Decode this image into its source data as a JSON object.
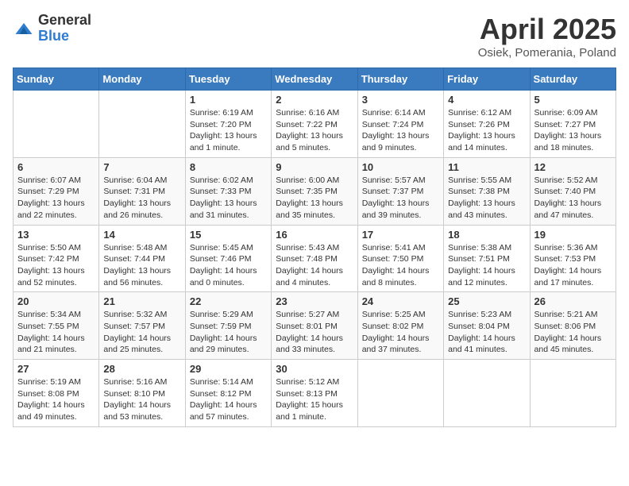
{
  "logo": {
    "general": "General",
    "blue": "Blue"
  },
  "header": {
    "month": "April 2025",
    "location": "Osiek, Pomerania, Poland"
  },
  "weekdays": [
    "Sunday",
    "Monday",
    "Tuesday",
    "Wednesday",
    "Thursday",
    "Friday",
    "Saturday"
  ],
  "weeks": [
    [
      {
        "day": "",
        "info": ""
      },
      {
        "day": "",
        "info": ""
      },
      {
        "day": "1",
        "info": "Sunrise: 6:19 AM\nSunset: 7:20 PM\nDaylight: 13 hours and 1 minute."
      },
      {
        "day": "2",
        "info": "Sunrise: 6:16 AM\nSunset: 7:22 PM\nDaylight: 13 hours and 5 minutes."
      },
      {
        "day": "3",
        "info": "Sunrise: 6:14 AM\nSunset: 7:24 PM\nDaylight: 13 hours and 9 minutes."
      },
      {
        "day": "4",
        "info": "Sunrise: 6:12 AM\nSunset: 7:26 PM\nDaylight: 13 hours and 14 minutes."
      },
      {
        "day": "5",
        "info": "Sunrise: 6:09 AM\nSunset: 7:27 PM\nDaylight: 13 hours and 18 minutes."
      }
    ],
    [
      {
        "day": "6",
        "info": "Sunrise: 6:07 AM\nSunset: 7:29 PM\nDaylight: 13 hours and 22 minutes."
      },
      {
        "day": "7",
        "info": "Sunrise: 6:04 AM\nSunset: 7:31 PM\nDaylight: 13 hours and 26 minutes."
      },
      {
        "day": "8",
        "info": "Sunrise: 6:02 AM\nSunset: 7:33 PM\nDaylight: 13 hours and 31 minutes."
      },
      {
        "day": "9",
        "info": "Sunrise: 6:00 AM\nSunset: 7:35 PM\nDaylight: 13 hours and 35 minutes."
      },
      {
        "day": "10",
        "info": "Sunrise: 5:57 AM\nSunset: 7:37 PM\nDaylight: 13 hours and 39 minutes."
      },
      {
        "day": "11",
        "info": "Sunrise: 5:55 AM\nSunset: 7:38 PM\nDaylight: 13 hours and 43 minutes."
      },
      {
        "day": "12",
        "info": "Sunrise: 5:52 AM\nSunset: 7:40 PM\nDaylight: 13 hours and 47 minutes."
      }
    ],
    [
      {
        "day": "13",
        "info": "Sunrise: 5:50 AM\nSunset: 7:42 PM\nDaylight: 13 hours and 52 minutes."
      },
      {
        "day": "14",
        "info": "Sunrise: 5:48 AM\nSunset: 7:44 PM\nDaylight: 13 hours and 56 minutes."
      },
      {
        "day": "15",
        "info": "Sunrise: 5:45 AM\nSunset: 7:46 PM\nDaylight: 14 hours and 0 minutes."
      },
      {
        "day": "16",
        "info": "Sunrise: 5:43 AM\nSunset: 7:48 PM\nDaylight: 14 hours and 4 minutes."
      },
      {
        "day": "17",
        "info": "Sunrise: 5:41 AM\nSunset: 7:50 PM\nDaylight: 14 hours and 8 minutes."
      },
      {
        "day": "18",
        "info": "Sunrise: 5:38 AM\nSunset: 7:51 PM\nDaylight: 14 hours and 12 minutes."
      },
      {
        "day": "19",
        "info": "Sunrise: 5:36 AM\nSunset: 7:53 PM\nDaylight: 14 hours and 17 minutes."
      }
    ],
    [
      {
        "day": "20",
        "info": "Sunrise: 5:34 AM\nSunset: 7:55 PM\nDaylight: 14 hours and 21 minutes."
      },
      {
        "day": "21",
        "info": "Sunrise: 5:32 AM\nSunset: 7:57 PM\nDaylight: 14 hours and 25 minutes."
      },
      {
        "day": "22",
        "info": "Sunrise: 5:29 AM\nSunset: 7:59 PM\nDaylight: 14 hours and 29 minutes."
      },
      {
        "day": "23",
        "info": "Sunrise: 5:27 AM\nSunset: 8:01 PM\nDaylight: 14 hours and 33 minutes."
      },
      {
        "day": "24",
        "info": "Sunrise: 5:25 AM\nSunset: 8:02 PM\nDaylight: 14 hours and 37 minutes."
      },
      {
        "day": "25",
        "info": "Sunrise: 5:23 AM\nSunset: 8:04 PM\nDaylight: 14 hours and 41 minutes."
      },
      {
        "day": "26",
        "info": "Sunrise: 5:21 AM\nSunset: 8:06 PM\nDaylight: 14 hours and 45 minutes."
      }
    ],
    [
      {
        "day": "27",
        "info": "Sunrise: 5:19 AM\nSunset: 8:08 PM\nDaylight: 14 hours and 49 minutes."
      },
      {
        "day": "28",
        "info": "Sunrise: 5:16 AM\nSunset: 8:10 PM\nDaylight: 14 hours and 53 minutes."
      },
      {
        "day": "29",
        "info": "Sunrise: 5:14 AM\nSunset: 8:12 PM\nDaylight: 14 hours and 57 minutes."
      },
      {
        "day": "30",
        "info": "Sunrise: 5:12 AM\nSunset: 8:13 PM\nDaylight: 15 hours and 1 minute."
      },
      {
        "day": "",
        "info": ""
      },
      {
        "day": "",
        "info": ""
      },
      {
        "day": "",
        "info": ""
      }
    ]
  ]
}
